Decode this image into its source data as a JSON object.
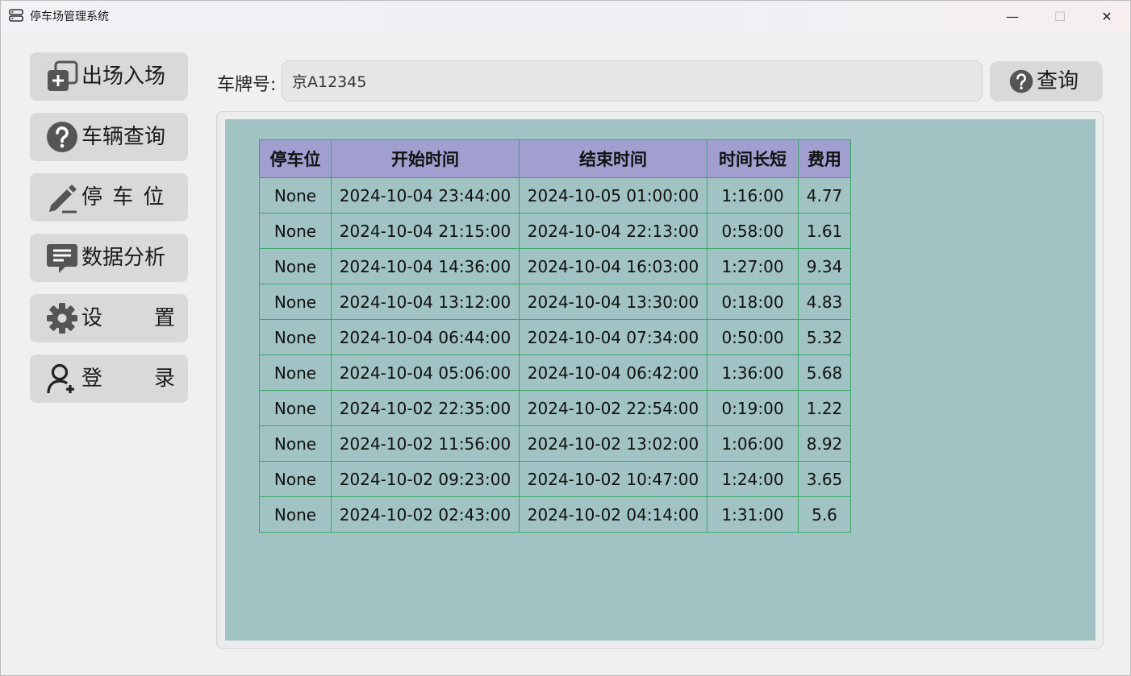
{
  "window": {
    "title": "停车场管理系统",
    "controls": {
      "minimize": "—",
      "maximize": "☐",
      "close": "✕"
    }
  },
  "sidebar": {
    "items": [
      {
        "label": "出场入场",
        "icon": "enter-exit-icon"
      },
      {
        "label": "车辆查询",
        "icon": "question-icon"
      },
      {
        "label": "停 车 位",
        "icon": "pencil-icon"
      },
      {
        "label": "数据分析",
        "icon": "chat-bubble-icon"
      },
      {
        "label_parts": [
          "设",
          "置"
        ],
        "icon": "gear-icon"
      },
      {
        "label_parts": [
          "登",
          "录"
        ],
        "icon": "user-add-icon"
      }
    ]
  },
  "search": {
    "label": "车牌号:",
    "value": "京A12345",
    "button_label": "查询",
    "button_icon": "question-icon"
  },
  "table": {
    "headers": [
      "停车位",
      "开始时间",
      "结束时间",
      "时间长短",
      "费用"
    ],
    "rows": [
      [
        "None",
        "2024-10-04 23:44:00",
        "2024-10-05 01:00:00",
        "1:16:00",
        "4.77"
      ],
      [
        "None",
        "2024-10-04 21:15:00",
        "2024-10-04 22:13:00",
        "0:58:00",
        "1.61"
      ],
      [
        "None",
        "2024-10-04 14:36:00",
        "2024-10-04 16:03:00",
        "1:27:00",
        "9.34"
      ],
      [
        "None",
        "2024-10-04 13:12:00",
        "2024-10-04 13:30:00",
        "0:18:00",
        "4.83"
      ],
      [
        "None",
        "2024-10-04 06:44:00",
        "2024-10-04 07:34:00",
        "0:50:00",
        "5.32"
      ],
      [
        "None",
        "2024-10-04 05:06:00",
        "2024-10-04 06:42:00",
        "1:36:00",
        "5.68"
      ],
      [
        "None",
        "2024-10-02 22:35:00",
        "2024-10-02 22:54:00",
        "0:19:00",
        "1.22"
      ],
      [
        "None",
        "2024-10-02 11:56:00",
        "2024-10-02 13:02:00",
        "1:06:00",
        "8.92"
      ],
      [
        "None",
        "2024-10-02 09:23:00",
        "2024-10-02 10:47:00",
        "1:24:00",
        "3.65"
      ],
      [
        "None",
        "2024-10-02 02:43:00",
        "2024-10-02 04:14:00",
        "1:31:00",
        "5.6"
      ]
    ]
  },
  "colors": {
    "header_bg": "#a09fd0",
    "grid_line": "#3aa76a",
    "table_area_bg": "#a1c3c3",
    "button_bg": "#d9d9d9",
    "icon_dark": "#555555"
  }
}
